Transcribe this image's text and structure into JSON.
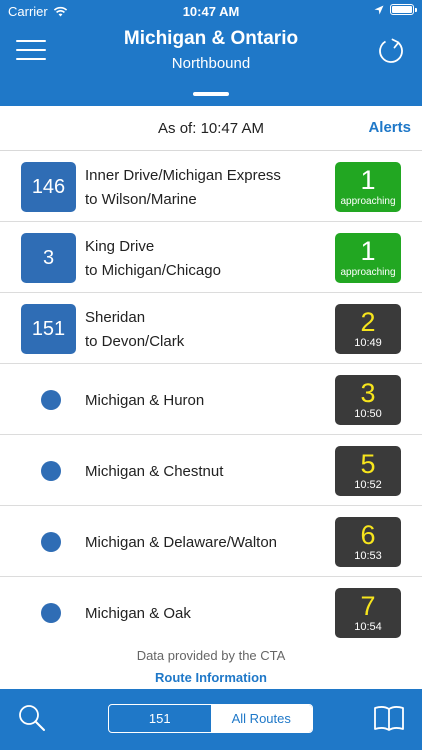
{
  "status_bar": {
    "carrier": "Carrier",
    "time": "10:47 AM",
    "battery_level": 1.0
  },
  "header": {
    "title": "Michigan & Ontario",
    "subtitle": "Northbound",
    "menu_icon": "hamburger-menu-icon",
    "refresh_icon": "refresh-icon",
    "background_color": "#1f78c8"
  },
  "info": {
    "as_of": "As of: 10:47 AM",
    "alerts_label": "Alerts"
  },
  "arrivals": [
    {
      "route": "146",
      "line1": "Inner Drive/Michigan Express",
      "line2": "to Wilson/Marine",
      "minutes": "1",
      "detail": "approaching",
      "style": "green"
    },
    {
      "route": "3",
      "line1": "King Drive",
      "line2": "to Michigan/Chicago",
      "minutes": "1",
      "detail": "approaching",
      "style": "green"
    },
    {
      "route": "151",
      "line1": "Sheridan",
      "line2": "to Devon/Clark",
      "minutes": "2",
      "detail": "10:49",
      "style": "dark"
    },
    {
      "stop": "Michigan & Huron",
      "minutes": "3",
      "detail": "10:50",
      "style": "dark"
    },
    {
      "stop": "Michigan & Chestnut",
      "minutes": "5",
      "detail": "10:52",
      "style": "dark"
    },
    {
      "stop": "Michigan & Delaware/Walton",
      "minutes": "6",
      "detail": "10:53",
      "style": "dark"
    },
    {
      "stop": "Michigan & Oak",
      "minutes": "7",
      "detail": "10:54",
      "style": "dark"
    }
  ],
  "footer": {
    "credit": "Data provided by the CTA",
    "route_info": "Route Information"
  },
  "toolbar": {
    "search_icon": "search-icon",
    "segment_left": "151",
    "segment_right": "All Routes",
    "selected_segment": "All Routes",
    "book_icon": "book-icon"
  }
}
